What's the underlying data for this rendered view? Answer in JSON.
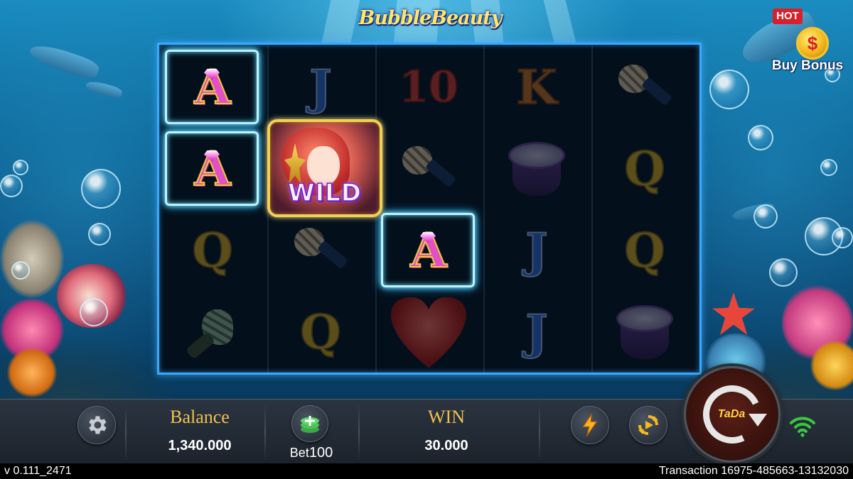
{
  "game": {
    "title": "BubbleBeauty",
    "buy_bonus": {
      "badge": "HOT",
      "coin_symbol": "$",
      "label": "Buy Bonus"
    }
  },
  "reels": {
    "columns": 5,
    "rows": 4,
    "grid": [
      [
        "A",
        "J",
        "10",
        "K",
        "shell"
      ],
      [
        "A",
        "WILD",
        "shell",
        "drum",
        "Q"
      ],
      [
        "Q",
        "shell",
        "A",
        "J",
        "Q"
      ],
      [
        "horn",
        "Q",
        "heart",
        "J",
        "drum"
      ]
    ],
    "winning_cells": [
      [
        0,
        0
      ],
      [
        1,
        0
      ],
      [
        2,
        2
      ]
    ],
    "wild_label": "WILD"
  },
  "bottom_bar": {
    "settings_icon": "gear-icon",
    "balance_label": "Balance",
    "balance_value": "1,340.000",
    "bet_icon": "coin-stack-plus-icon",
    "bet_label": "Bet",
    "bet_value": "100",
    "win_label": "WIN",
    "win_value": "30.000",
    "turbo_icon": "lightning-icon",
    "autoplay_icon": "autoplay-icon",
    "spin_label": "TaDa",
    "signal_icon": "wifi-icon"
  },
  "footer": {
    "version": "v 0.111_2471",
    "transaction": "Transaction 16975-485663-13132030"
  },
  "colors": {
    "reel_border": "#3aa8ff",
    "win_frame": "#bff2ff",
    "gold_label": "#f2c14d",
    "turbo": "#ffb020",
    "wifi": "#39c83f"
  }
}
